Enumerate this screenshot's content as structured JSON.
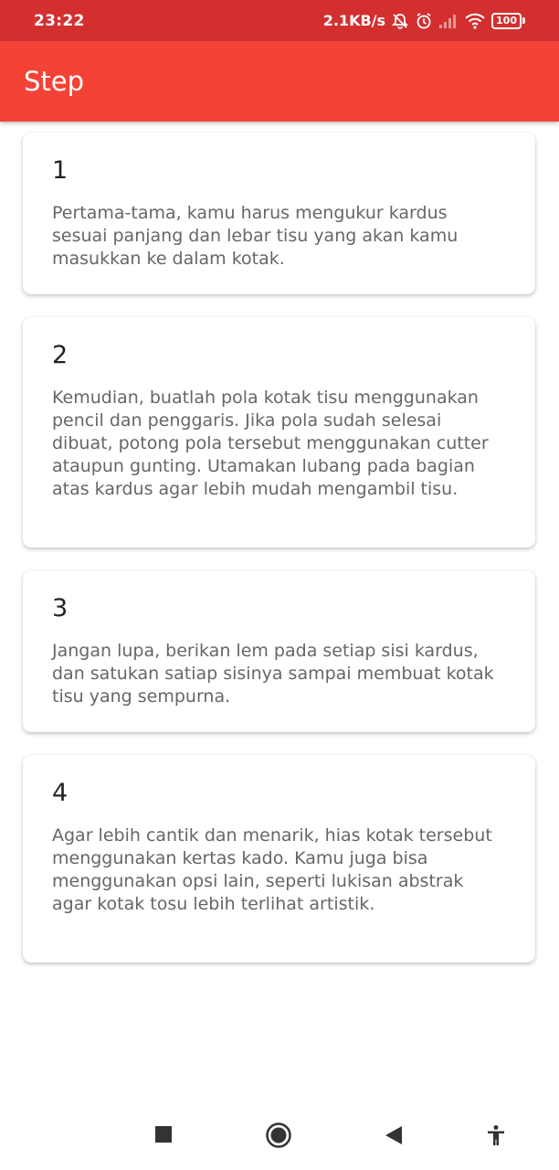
{
  "status_bar": {
    "time": "23:22",
    "speed": "2.1KB/s",
    "battery": "100",
    "icons": [
      "bell-off-icon",
      "alarm-icon",
      "signal-icon",
      "wifi-icon",
      "battery-icon"
    ]
  },
  "app_bar": {
    "title": "Step"
  },
  "steps": [
    {
      "number": "1",
      "text": "Pertama-tama, kamu harus mengukur kardus sesuai panjang dan lebar tisu yang akan kamu masukkan ke dalam kotak."
    },
    {
      "number": "2",
      "text": "Kemudian, buatlah pola kotak tisu menggunakan pencil dan penggaris. Jika pola sudah selesai dibuat, potong pola tersebut menggunakan cutter ataupun gunting. Utamakan lubang pada bagian atas kardus agar lebih mudah mengambil tisu."
    },
    {
      "number": "3",
      "text": "Jangan lupa, berikan lem pada setiap sisi kardus, dan satukan satiap sisinya sampai membuat kotak tisu yang sempurna."
    },
    {
      "number": "4",
      "text": "Agar lebih cantik dan menarik, hias kotak tersebut menggunakan kertas kado. Kamu juga bisa menggunakan opsi lain, seperti lukisan abstrak agar kotak tosu lebih terlihat artistik."
    }
  ],
  "nav_bar": {
    "buttons": [
      "recents-square-icon",
      "home-circle-icon",
      "back-triangle-icon",
      "accessibility-icon"
    ]
  },
  "colors": {
    "status_bar": "#d32f2f",
    "app_bar": "#f44336",
    "body_text": "#666666"
  }
}
